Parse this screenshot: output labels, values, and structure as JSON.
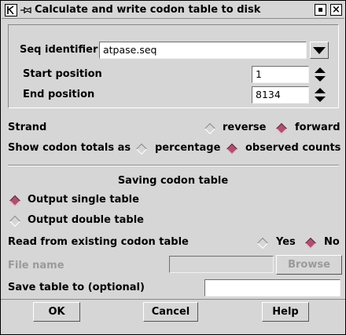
{
  "window": {
    "title": "Calculate and write codon table to disk",
    "iconify_symbol": "▪",
    "close_symbol": "×"
  },
  "seq": {
    "identifier_label": "Seq identifier",
    "identifier_value": "atpase.seq",
    "start_label": "Start position",
    "start_value": "1",
    "end_label": "End position",
    "end_value": "8134"
  },
  "strand": {
    "label": "Strand",
    "options": [
      "reverse",
      "forward"
    ],
    "selected": "forward"
  },
  "codon_totals": {
    "label": "Show codon totals as",
    "options": [
      "percentage",
      "observed counts"
    ],
    "selected": "observed counts"
  },
  "saving": {
    "heading": "Saving codon table",
    "options": [
      "Output single table",
      "Output double table"
    ],
    "selected": "Output single table"
  },
  "existing": {
    "label": "Read from existing codon table",
    "options": [
      "Yes",
      "No"
    ],
    "selected": "No",
    "file_name_label": "File name",
    "file_name_value": "",
    "browse_label": "Browse"
  },
  "save_to": {
    "label": "Save table to (optional)",
    "value": ""
  },
  "buttons": {
    "ok": "OK",
    "cancel": "Cancel",
    "help": "Help"
  }
}
